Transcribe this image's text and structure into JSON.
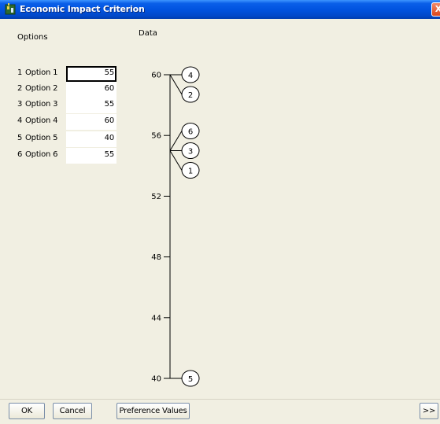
{
  "window": {
    "title": "Economic Impact Criterion",
    "close_label": "X"
  },
  "options_panel": {
    "header": "Options",
    "rows": [
      {
        "num": "1",
        "name": "Option 1",
        "value": "55"
      },
      {
        "num": "2",
        "name": "Option 2",
        "value": "60"
      },
      {
        "num": "3",
        "name": "Option 3",
        "value": "55"
      },
      {
        "num": "4",
        "name": "Option 4",
        "value": "60"
      },
      {
        "num": "5",
        "name": "Option 5",
        "value": "40"
      },
      {
        "num": "6",
        "name": "Option 6",
        "value": "55"
      }
    ]
  },
  "data_scale": {
    "header": "Data",
    "ticks": [
      "60",
      "56",
      "52",
      "48",
      "44",
      "40"
    ],
    "tick_values": [
      60,
      56,
      52,
      48,
      44,
      40
    ],
    "range": [
      40,
      60
    ],
    "markers": [
      {
        "label": "4",
        "value": 60
      },
      {
        "label": "2",
        "value": 60
      },
      {
        "label": "6",
        "value": 55
      },
      {
        "label": "3",
        "value": 55
      },
      {
        "label": "1",
        "value": 55
      },
      {
        "label": "5",
        "value": 40
      }
    ]
  },
  "buttons": {
    "ok": "OK",
    "cancel": "Cancel",
    "preference_values": "Preference Values",
    "more": ">>"
  },
  "colors": {
    "title_bar": "#0153e0",
    "window_bg": "#f1efe2",
    "close_button": "#d9461c"
  }
}
